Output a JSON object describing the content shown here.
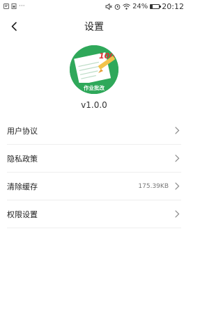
{
  "status_bar": {
    "left_icons": [
      "notification-icon",
      "sim-card-icon",
      "more-icon"
    ],
    "right_icons": [
      "mute-icon",
      "alarm-icon",
      "wifi-icon"
    ],
    "battery_text": "24%",
    "battery_level": 0.24,
    "time": "20:12"
  },
  "header": {
    "title": "设置"
  },
  "app": {
    "logo_score": "100",
    "logo_caption": "作业批改",
    "version": "v1.0.0"
  },
  "settings": {
    "items": [
      {
        "label": "用户协议",
        "value": ""
      },
      {
        "label": "隐私政策",
        "value": ""
      },
      {
        "label": "清除缓存",
        "value": "175.39KB"
      },
      {
        "label": "权限设置",
        "value": ""
      }
    ]
  },
  "colors": {
    "logo_green": "#2fa85a",
    "divider": "#eeeeee",
    "text": "#222222",
    "secondary_text": "#777777"
  }
}
